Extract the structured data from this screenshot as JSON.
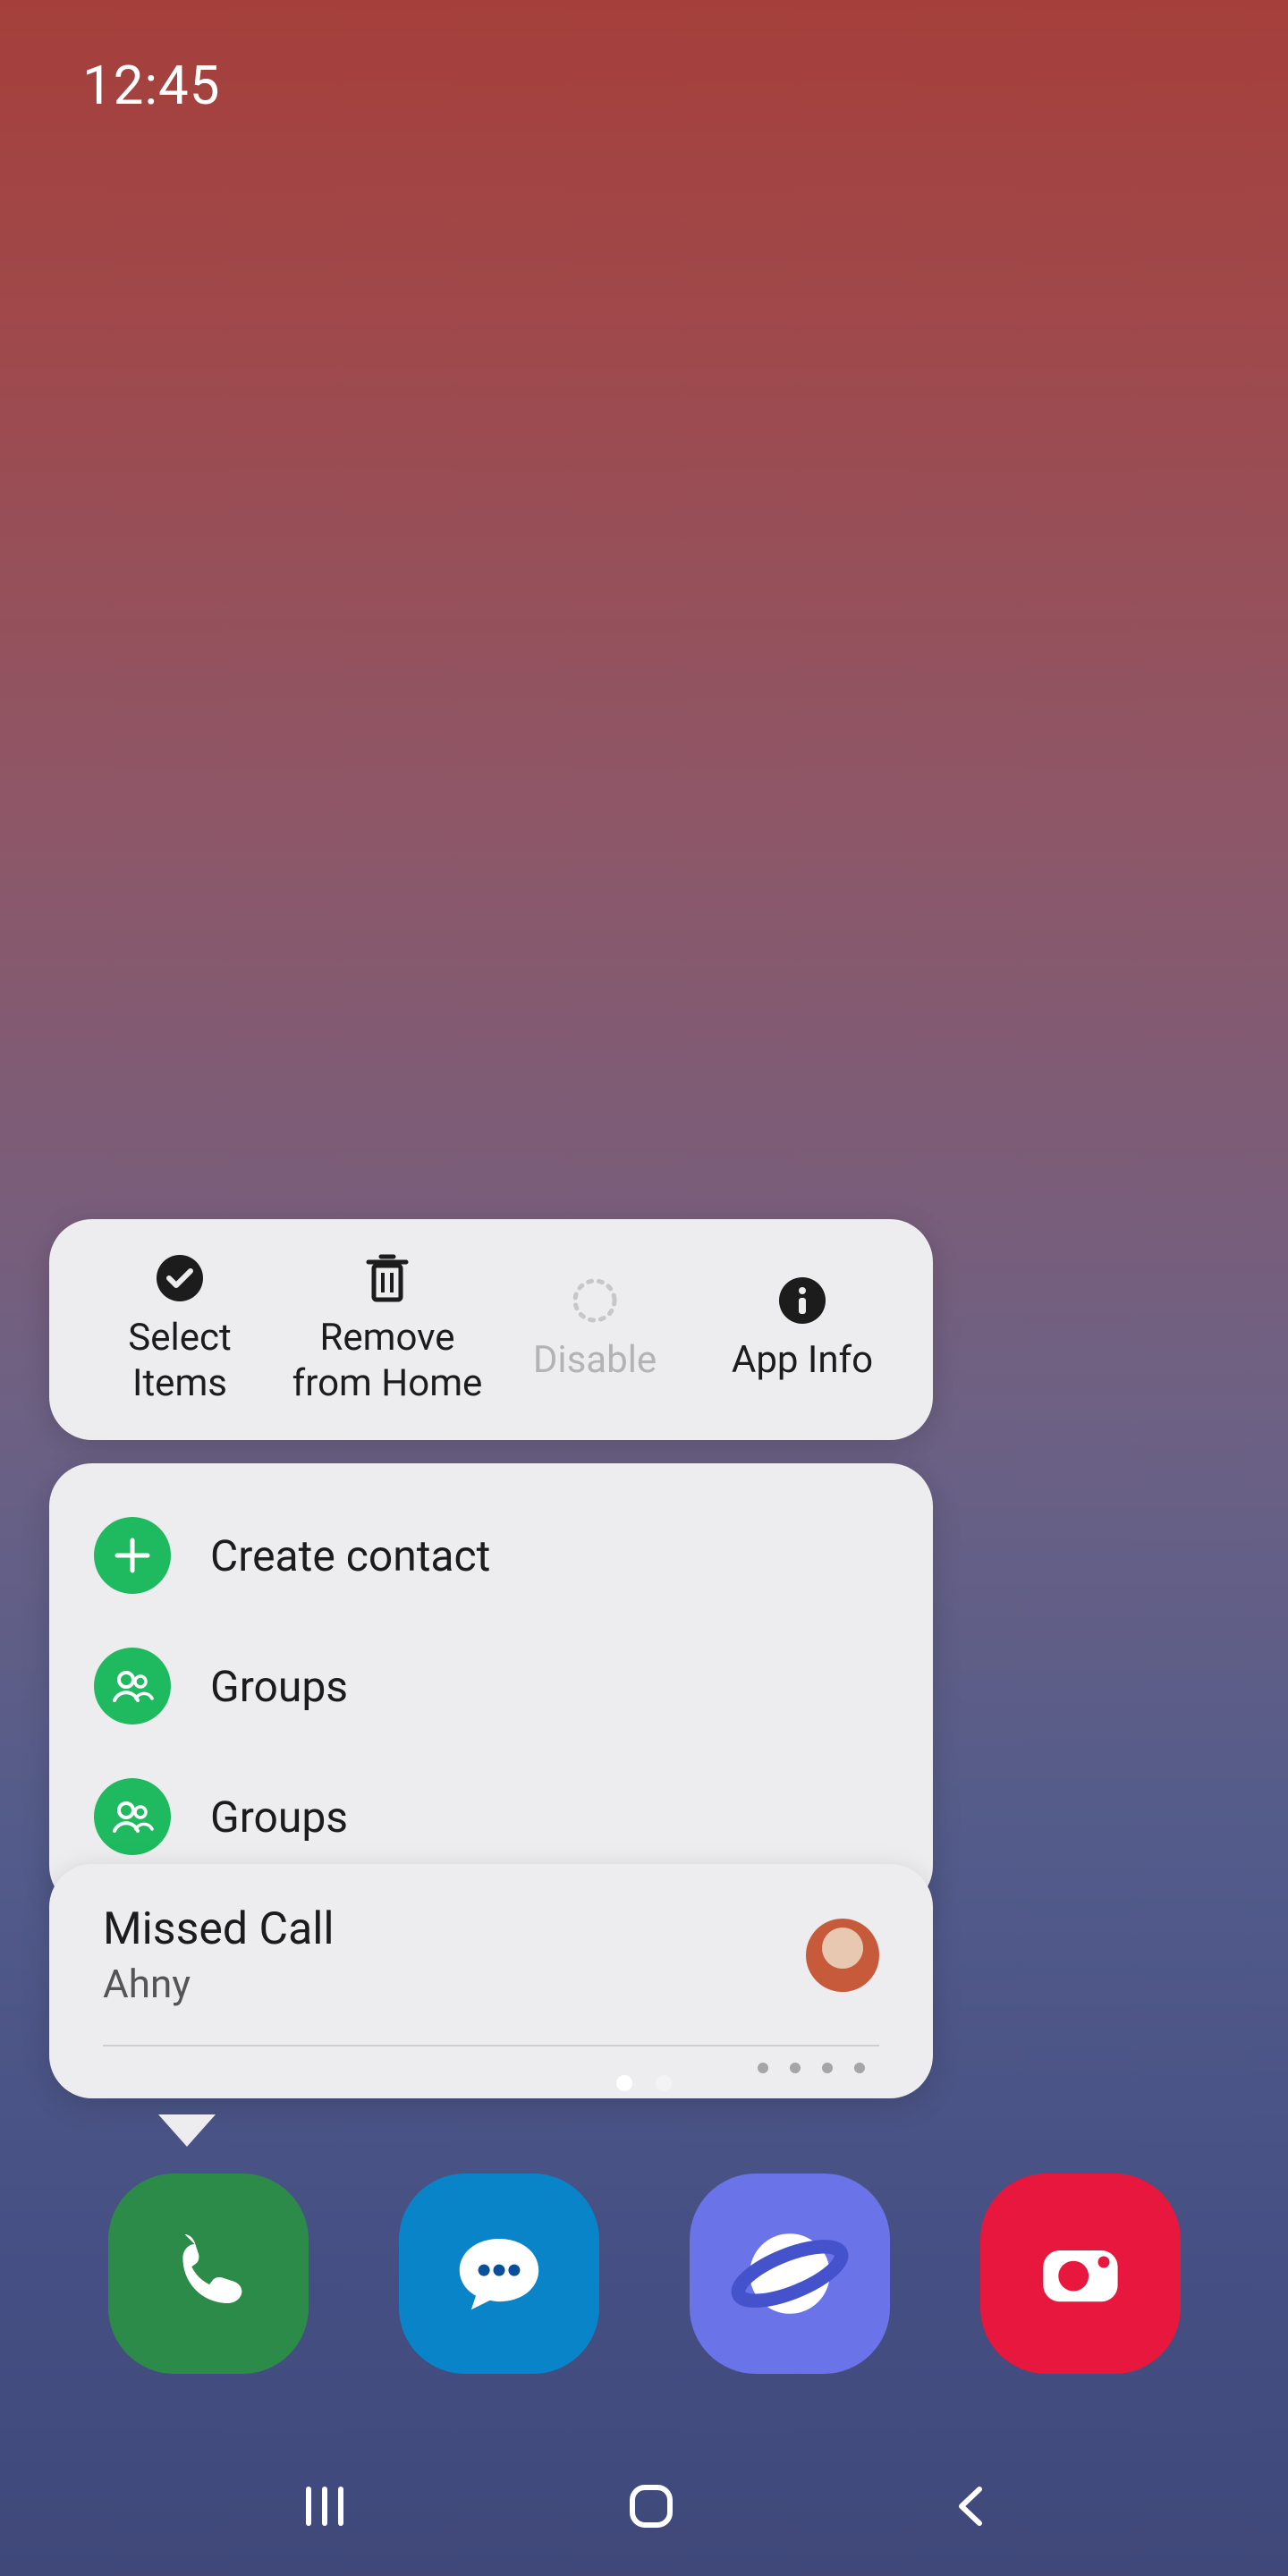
{
  "status": {
    "time": "12:45"
  },
  "context_menu": {
    "actions": [
      {
        "label": "Select\nItems",
        "icon": "check-circle",
        "disabled": false
      },
      {
        "label": "Remove\nfrom Home",
        "icon": "trash",
        "disabled": false
      },
      {
        "label": "Disable",
        "icon": "dotted-circle",
        "disabled": true
      },
      {
        "label": "App Info",
        "icon": "info-circle",
        "disabled": false
      }
    ],
    "shortcuts": [
      {
        "label": "Create contact",
        "icon": "plus",
        "color": "#1fba5f"
      },
      {
        "label": "Groups",
        "icon": "people",
        "color": "#1fba5f"
      },
      {
        "label": "Groups",
        "icon": "people",
        "color": "#1fba5f"
      }
    ],
    "notification": {
      "title": "Missed Call",
      "subtitle": "Ahny",
      "page_dots": 4
    }
  },
  "home": {
    "page_indicator": {
      "count": 2,
      "active": 0
    }
  },
  "dock": {
    "apps": [
      {
        "name": "phone",
        "color": "#2d8b4a"
      },
      {
        "name": "messages",
        "color": "#0a84c8"
      },
      {
        "name": "browser",
        "color": "#6a73e8"
      },
      {
        "name": "camera",
        "color": "#e8173d"
      }
    ]
  }
}
